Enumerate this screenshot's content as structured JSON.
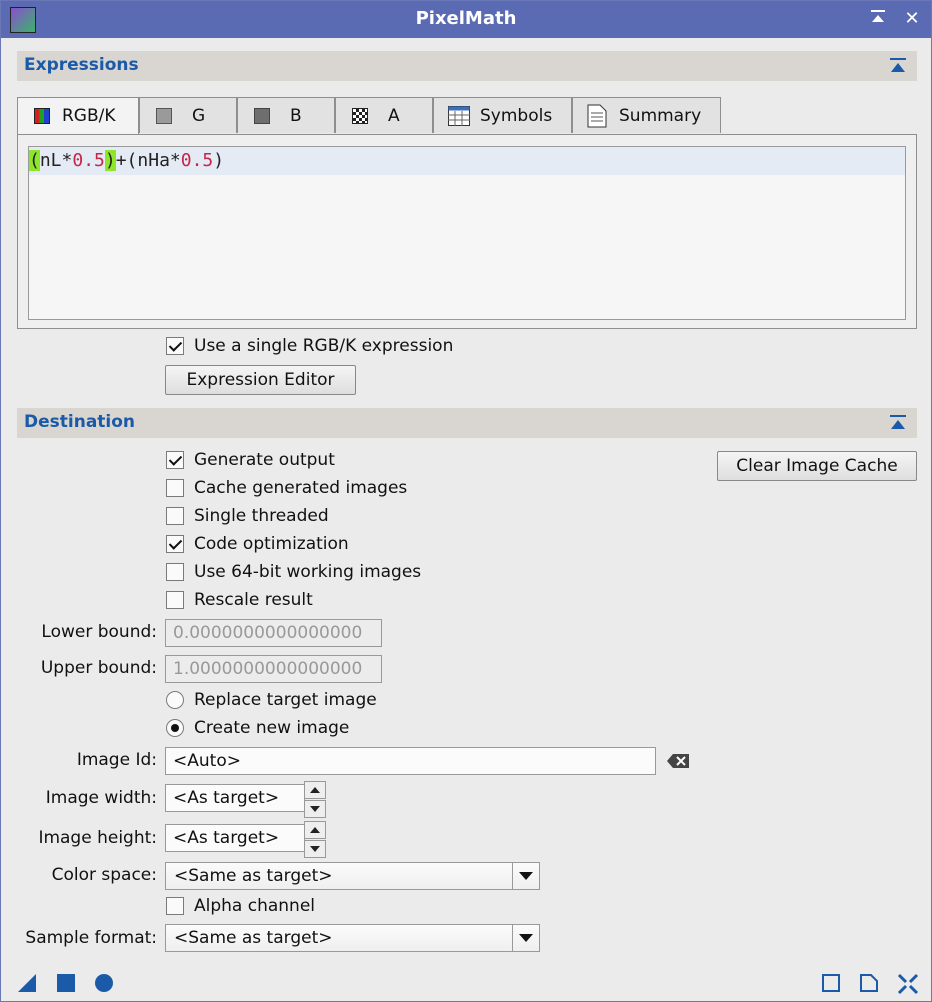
{
  "window": {
    "title": "PixelMath"
  },
  "colors": {
    "titlebar": "#5a6bb4",
    "section_label": "#1a5aa8",
    "icon_blue": "#1a5aa8"
  },
  "expressions": {
    "header": "Expressions",
    "tabs": [
      {
        "label": "RGB/K",
        "icon": "rgb-channel-icon",
        "active": true
      },
      {
        "label": "G",
        "icon": "green-channel-icon"
      },
      {
        "label": "B",
        "icon": "blue-channel-icon"
      },
      {
        "label": "A",
        "icon": "alpha-channel-icon"
      },
      {
        "label": "Symbols",
        "icon": "table-icon"
      },
      {
        "label": "Summary",
        "icon": "document-icon"
      }
    ],
    "editor_tokens": [
      "(",
      "nL*",
      "0.5",
      ")",
      "+(nHa*",
      "0.5",
      ")"
    ],
    "single_expression": {
      "label": "Use a single RGB/K expression",
      "checked": true
    },
    "editor_button": "Expression Editor"
  },
  "destination": {
    "header": "Destination",
    "clear_cache_button": "Clear Image Cache",
    "options": [
      {
        "label": "Generate output",
        "checked": true
      },
      {
        "label": "Cache generated images",
        "checked": false
      },
      {
        "label": "Single threaded",
        "checked": false
      },
      {
        "label": "Code optimization",
        "checked": true
      },
      {
        "label": "Use 64-bit working images",
        "checked": false
      },
      {
        "label": "Rescale result",
        "checked": false
      }
    ],
    "lower_bound": {
      "label": "Lower bound:",
      "value": "0.0000000000000000"
    },
    "upper_bound": {
      "label": "Upper bound:",
      "value": "1.0000000000000000"
    },
    "radios": [
      {
        "label": "Replace target image",
        "selected": false
      },
      {
        "label": "Create new image",
        "selected": true
      }
    ],
    "image_id": {
      "label": "Image Id:",
      "value": "<Auto>"
    },
    "image_width": {
      "label": "Image width:",
      "value": "<As target>"
    },
    "image_height": {
      "label": "Image height:",
      "value": "<As target>"
    },
    "color_space": {
      "label": "Color space:",
      "value": "<Same as target>"
    },
    "alpha_channel": {
      "label": "Alpha channel",
      "checked": false
    },
    "sample_format": {
      "label": "Sample format:",
      "value": "<Same as target>"
    }
  },
  "bottom_icons": [
    "new-instance-icon",
    "apply-global-icon",
    "apply-icon",
    "browse-doc-icon",
    "reset-icon",
    "collapse-panel-icon"
  ]
}
